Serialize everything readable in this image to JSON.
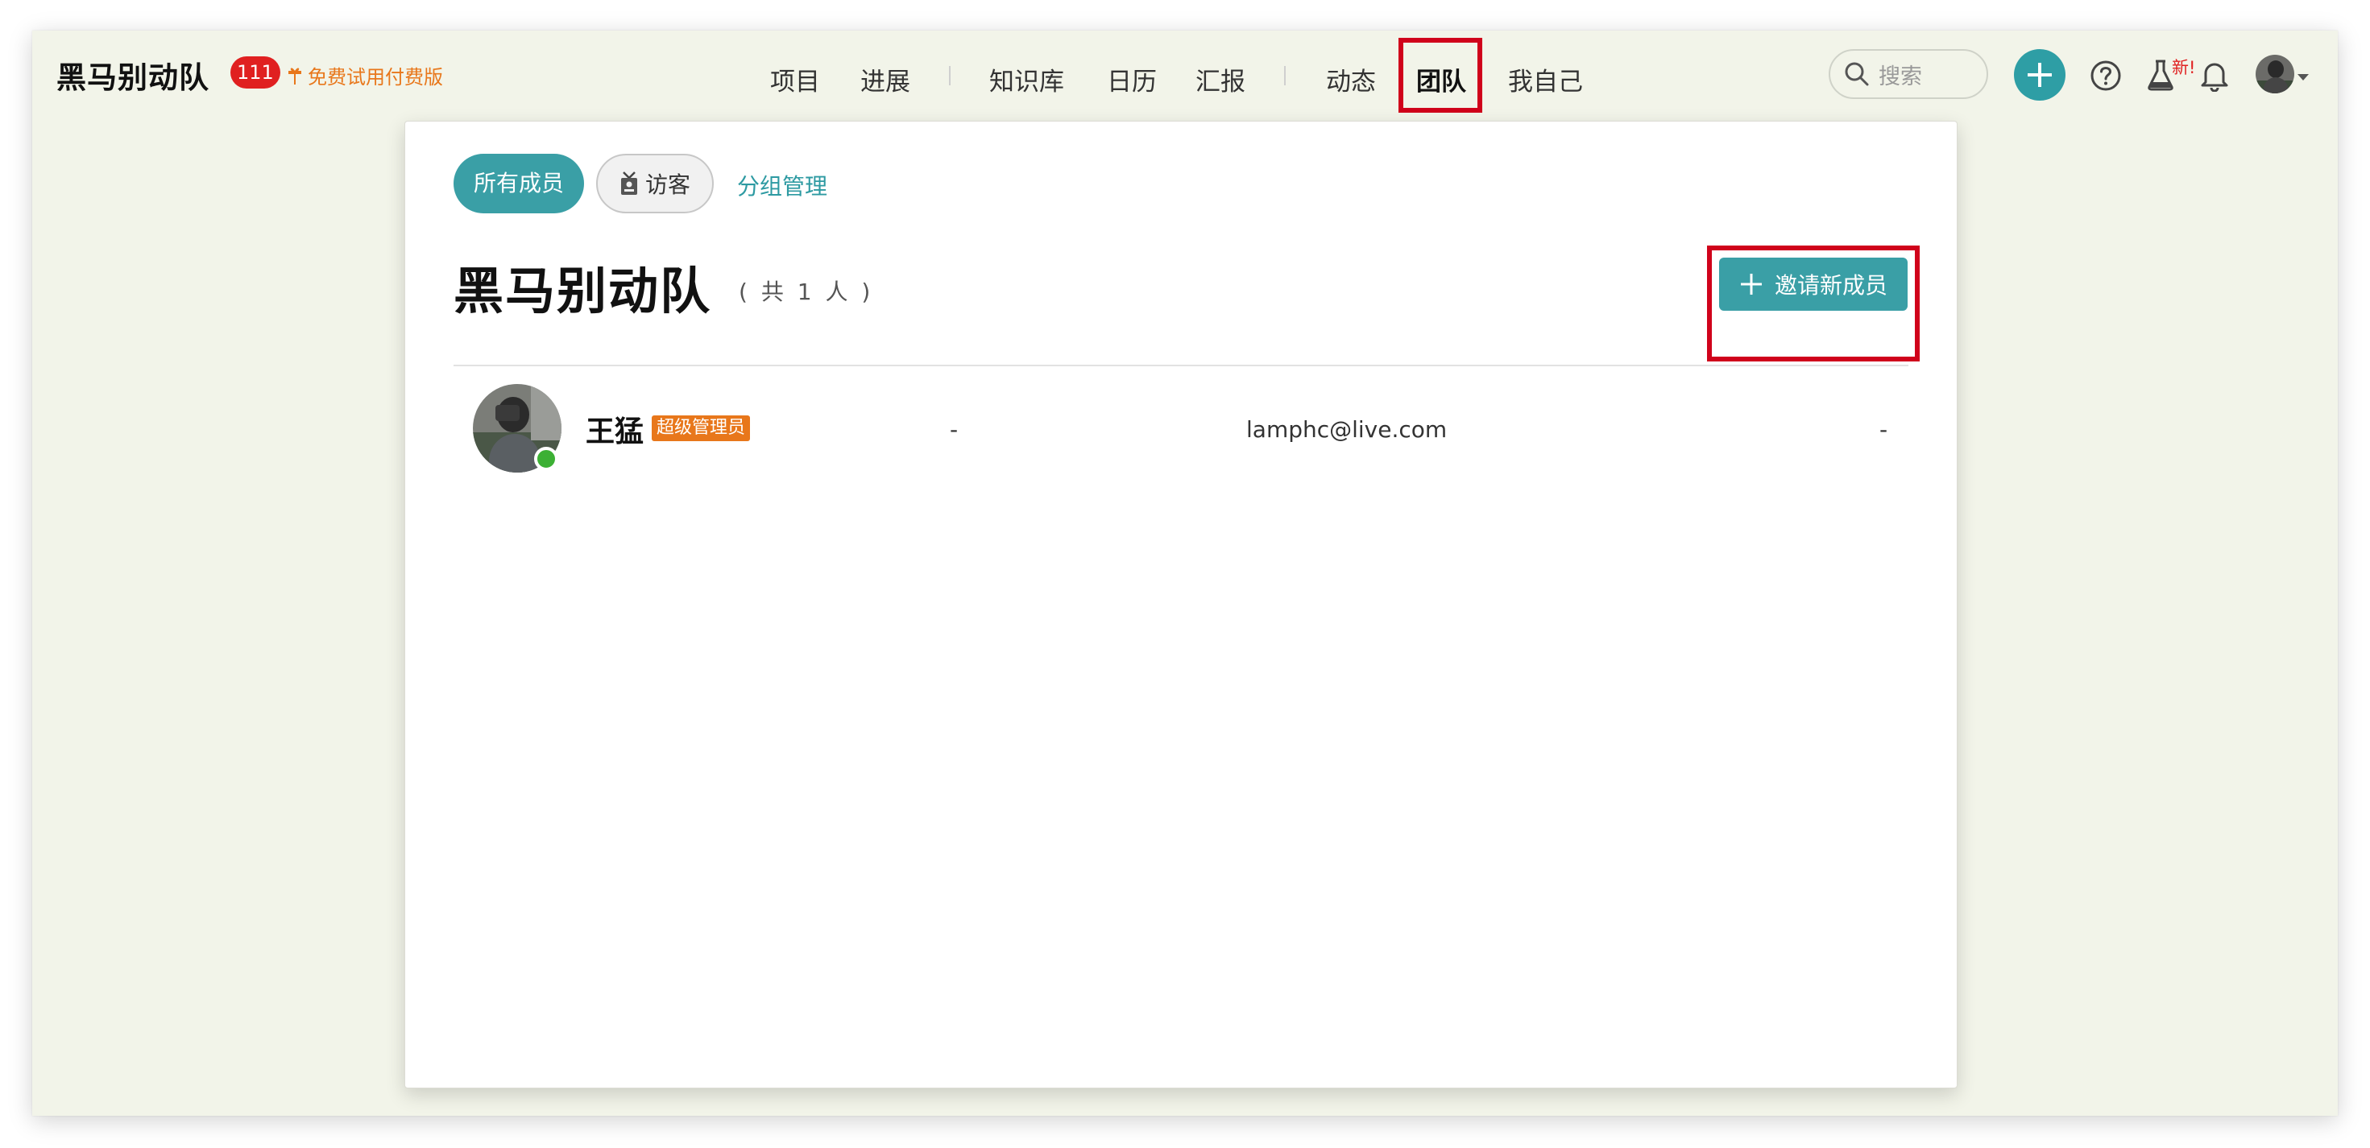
{
  "header": {
    "team_name": "黑马别动队",
    "notification_count": "111",
    "trial_label": "免费试用付费版"
  },
  "nav": {
    "items": [
      "项目",
      "进展",
      "知识库",
      "日历",
      "汇报",
      "动态",
      "团队",
      "我自己"
    ],
    "active": "团队"
  },
  "search": {
    "placeholder": "搜索"
  },
  "toolbar": {
    "new_badge": "新!"
  },
  "page": {
    "tabs": {
      "all_members": "所有成员",
      "guests": "访客",
      "group_manage": "分组管理"
    },
    "title": "黑马别动队",
    "count_text": "( 共 1 人 )",
    "invite_label": "邀请新成员"
  },
  "members": [
    {
      "name": "王猛",
      "role": "超级管理员",
      "col2": "-",
      "email": "lamphc@live.com",
      "col4": "-"
    }
  ],
  "colors": {
    "accent": "#3a9fa6",
    "highlight": "#d0021b",
    "badge": "#e02020",
    "role": "#e8771b",
    "online": "#3cb034"
  },
  "icons": [
    "gift-icon",
    "search-icon",
    "plus-icon",
    "help-icon",
    "lab-flask-icon",
    "bell-icon",
    "badge-icon",
    "online-status-icon"
  ]
}
